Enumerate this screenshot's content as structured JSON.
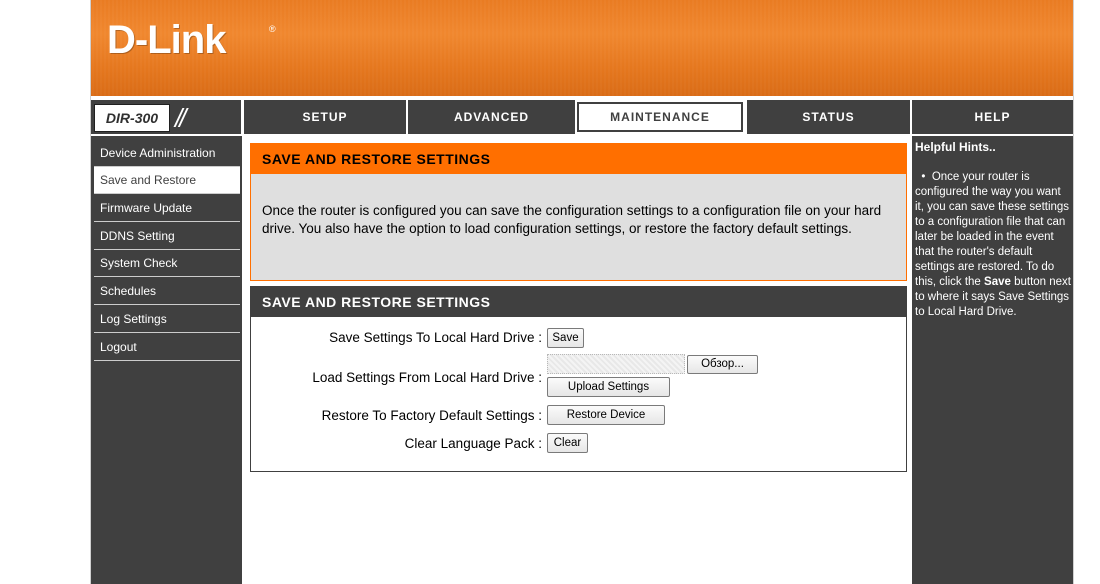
{
  "brand": {
    "logo_text": "D-Link",
    "reg_mark": "®",
    "model": "DIR-300",
    "slashes": "//"
  },
  "nav": {
    "tabs": [
      {
        "label": "SETUP"
      },
      {
        "label": "ADVANCED"
      },
      {
        "label": "MAINTENANCE"
      },
      {
        "label": "STATUS"
      },
      {
        "label": "HELP"
      }
    ],
    "active_tab": "MAINTENANCE"
  },
  "sidebar": {
    "items": [
      {
        "label": "Device Administration"
      },
      {
        "label": "Save and Restore"
      },
      {
        "label": "Firmware Update"
      },
      {
        "label": "DDNS Setting"
      },
      {
        "label": "System Check"
      },
      {
        "label": "Schedules"
      },
      {
        "label": "Log Settings"
      },
      {
        "label": "Logout"
      }
    ],
    "active_item": "Save and Restore"
  },
  "intro": {
    "title": "SAVE AND RESTORE SETTINGS",
    "text": "Once the router is configured you can save the configuration settings to a configuration file on your hard drive. You also have the option to load configuration settings, or restore the factory default settings."
  },
  "settings": {
    "title": "SAVE AND RESTORE SETTINGS",
    "rows": {
      "save_label": "Save Settings To Local Hard Drive :",
      "save_button": "Save",
      "load_label": "Load Settings From Local Hard Drive :",
      "browse_button": "Обзор...",
      "upload_button": "Upload Settings",
      "restore_label": "Restore To Factory Default Settings :",
      "restore_button": "Restore Device",
      "clear_label": "Clear Language Pack :",
      "clear_button": "Clear"
    }
  },
  "help": {
    "title": "Helpful Hints..",
    "bullet": "•",
    "text_before": "Once your router is configured the way you want it, you can save these settings to a configuration file that can later be loaded in the event that the router's default settings are restored. To do this, click the",
    "bold": "Save",
    "text_after": "button next to where it says Save Settings to Local Hard Drive."
  },
  "colors": {
    "banner_orange": "#e97a20",
    "nav_dark": "#404040",
    "header_orange": "#ff6f00",
    "panel_gray": "#dfdfdf"
  }
}
